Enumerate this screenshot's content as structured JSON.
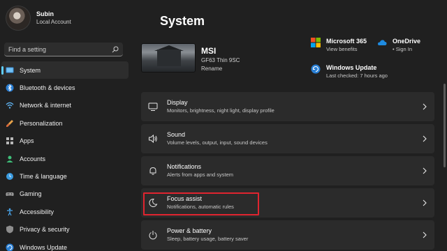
{
  "profile": {
    "name": "Subin",
    "account_type": "Local Account"
  },
  "search": {
    "placeholder": "Find a setting"
  },
  "nav": {
    "items": [
      {
        "label": "System",
        "icon": "monitor-icon",
        "active": true
      },
      {
        "label": "Bluetooth & devices",
        "icon": "bluetooth-icon"
      },
      {
        "label": "Network & internet",
        "icon": "wifi-icon"
      },
      {
        "label": "Personalization",
        "icon": "brush-icon"
      },
      {
        "label": "Apps",
        "icon": "apps-icon"
      },
      {
        "label": "Accounts",
        "icon": "person-icon"
      },
      {
        "label": "Time & language",
        "icon": "globe-clock-icon"
      },
      {
        "label": "Gaming",
        "icon": "gamepad-icon"
      },
      {
        "label": "Accessibility",
        "icon": "accessibility-icon"
      },
      {
        "label": "Privacy & security",
        "icon": "shield-icon"
      },
      {
        "label": "Windows Update",
        "icon": "update-icon"
      }
    ]
  },
  "page": {
    "title": "System"
  },
  "device": {
    "name": "MSI",
    "model": "GF63 Thin 9SC",
    "rename": "Rename"
  },
  "quick_links": {
    "microsoft365": {
      "title": "Microsoft 365",
      "sub": "View benefits"
    },
    "onedrive": {
      "title": "OneDrive",
      "sub": "• Sign In"
    },
    "windows_update": {
      "title": "Windows Update",
      "sub": "Last checked: 7 hours ago"
    }
  },
  "settings": [
    {
      "title": "Display",
      "sub": "Monitors, brightness, night light, display profile",
      "icon": "display-icon"
    },
    {
      "title": "Sound",
      "sub": "Volume levels, output, input, sound devices",
      "icon": "speaker-icon"
    },
    {
      "title": "Notifications",
      "sub": "Alerts from apps and system",
      "icon": "bell-icon"
    },
    {
      "title": "Focus assist",
      "sub": "Notifications, automatic rules",
      "icon": "moon-icon"
    },
    {
      "title": "Power & battery",
      "sub": "Sleep, battery usage, battery saver",
      "icon": "power-icon"
    }
  ],
  "colors": {
    "background": "#202020",
    "card": "#2b2b2b",
    "accent": "#60cdff",
    "highlight": "#e0242f"
  }
}
